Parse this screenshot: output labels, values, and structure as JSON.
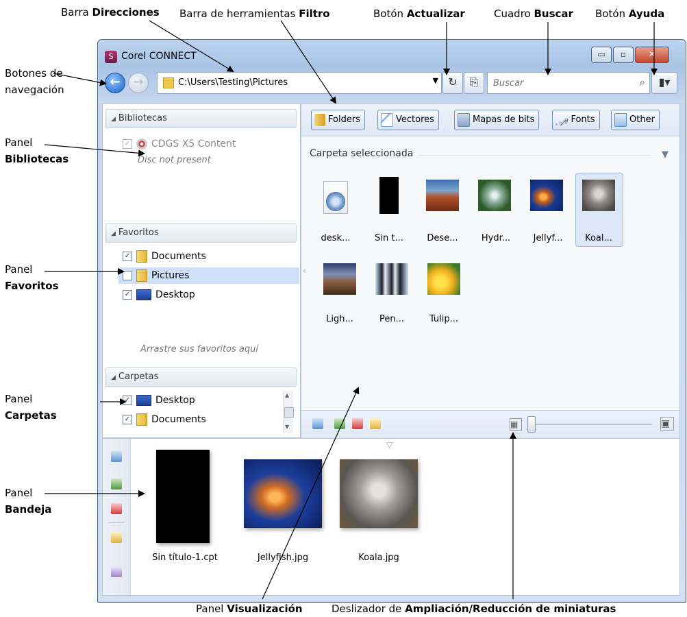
{
  "callouts": {
    "direcciones": {
      "pre": "Barra ",
      "bold": "Direcciones"
    },
    "filtro": {
      "pre": "Barra de herramientas ",
      "bold": "Filtro"
    },
    "actualizar": {
      "pre": "Botón ",
      "bold": "Actualizar"
    },
    "buscar": {
      "pre": "Cuadro ",
      "bold": "Buscar"
    },
    "ayuda": {
      "pre": "Botón ",
      "bold": "Ayuda"
    },
    "navegacion": {
      "line1": "Botones de",
      "line2": "navegación"
    },
    "bibliotecas": {
      "line1": "Panel",
      "bold": "Bibliotecas"
    },
    "favoritos": {
      "line1": "Panel",
      "bold": "Favoritos"
    },
    "carpetas": {
      "line1": "Panel",
      "bold": "Carpetas"
    },
    "bandeja": {
      "line1": "Panel",
      "bold": "Bandeja"
    },
    "visualizacion": {
      "pre": "Panel ",
      "bold": "Visualización"
    },
    "deslizador": {
      "pre": "Deslizador de ",
      "bold": "Ampliación/Reducción de miniaturas"
    }
  },
  "window": {
    "title": "Corel CONNECT",
    "address_path": "C:\\Users\\Testing\\Pictures",
    "search_placeholder": "Buscar"
  },
  "libraries": {
    "header": "Bibliotecas",
    "item": "CDGS X5 Content",
    "note": "Disc not present"
  },
  "favorites": {
    "header": "Favoritos",
    "items": [
      {
        "label": "Documents",
        "checked": true
      },
      {
        "label": "Pictures",
        "checked": false
      },
      {
        "label": "Desktop",
        "checked": true
      }
    ],
    "hint": "Arrastre sus favoritos aquí"
  },
  "folders": {
    "header": "Carpetas",
    "items": [
      {
        "label": "Desktop",
        "checked": true
      },
      {
        "label": "Documents",
        "checked": true
      }
    ]
  },
  "filters": [
    {
      "label": "Folders",
      "color": "#e3b13d"
    },
    {
      "label": "Vectores",
      "color": "#5a8fd6"
    },
    {
      "label": "Mapas de bits",
      "color": "#7f9cc5"
    },
    {
      "label": "Fonts",
      "color": "#9aa8c8"
    },
    {
      "label": "Other",
      "color": "#4e8fd2"
    }
  ],
  "viewer": {
    "section_title": "Carpeta seleccionada",
    "items": [
      {
        "label": "desk...",
        "kind": "file"
      },
      {
        "label": "Sin t...",
        "kind": "black"
      },
      {
        "label": "Dese...",
        "kind": "desert"
      },
      {
        "label": "Hydr...",
        "kind": "hydrangea"
      },
      {
        "label": "Jellyf...",
        "kind": "jellyfish"
      },
      {
        "label": "Koal...",
        "kind": "koala",
        "selected": true
      },
      {
        "label": "Ligh...",
        "kind": "lighthouse"
      },
      {
        "label": "Pen...",
        "kind": "penguins"
      },
      {
        "label": "Tulip...",
        "kind": "tulips"
      }
    ]
  },
  "tray": {
    "items": [
      {
        "label": "Sin título-1.cpt",
        "kind": "black"
      },
      {
        "label": "Jellyfish.jpg",
        "kind": "jellyfish"
      },
      {
        "label": "Koala.jpg",
        "kind": "koala"
      }
    ]
  }
}
